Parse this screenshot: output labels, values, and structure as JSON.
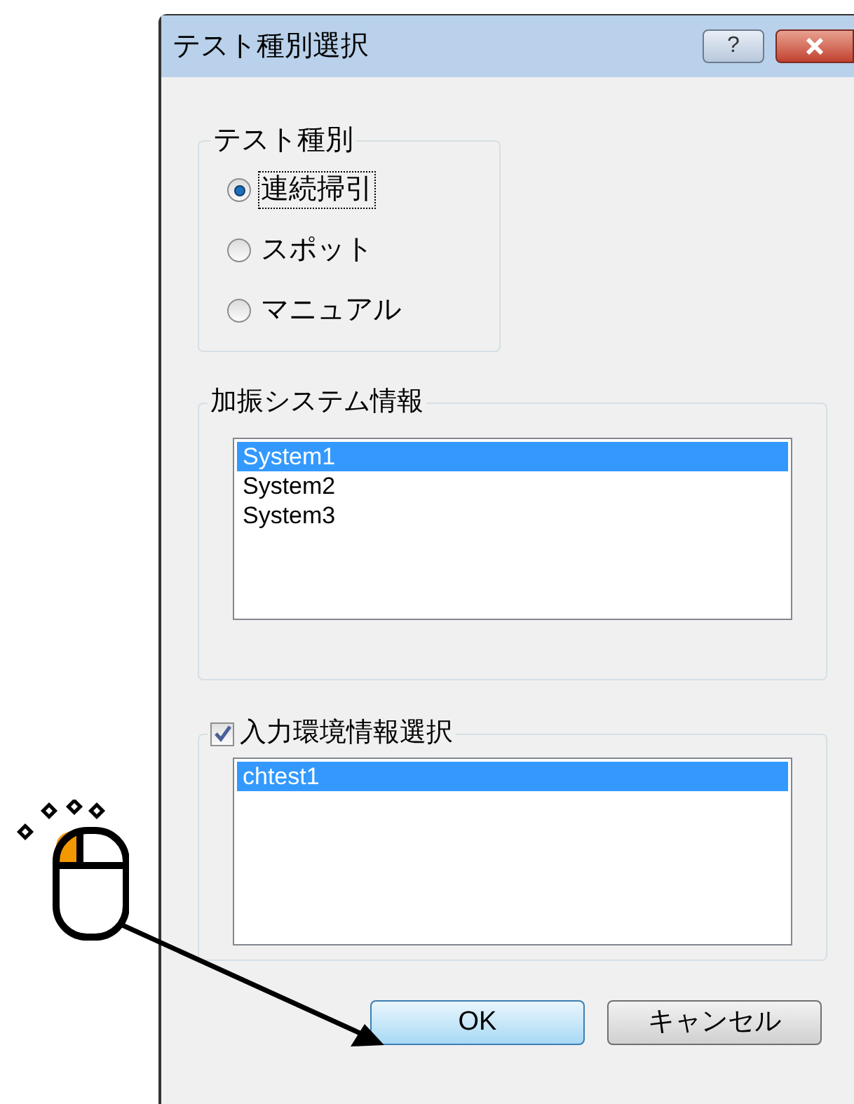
{
  "window": {
    "title": "テスト種別選択",
    "help_button": "?"
  },
  "test_type": {
    "label": "テスト種別",
    "options": [
      {
        "label": "連続掃引",
        "selected": true,
        "focused": true
      },
      {
        "label": "スポット",
        "selected": false,
        "focused": false
      },
      {
        "label": "マニュアル",
        "selected": false,
        "focused": false
      }
    ]
  },
  "system_info": {
    "label": "加振システム情報",
    "items": [
      {
        "label": "System1",
        "selected": true
      },
      {
        "label": "System2",
        "selected": false
      },
      {
        "label": "System3",
        "selected": false
      }
    ]
  },
  "input_env": {
    "label": "入力環境情報選択",
    "checked": true,
    "items": [
      {
        "label": "chtest1",
        "selected": true
      }
    ]
  },
  "buttons": [
    {
      "label": "OK",
      "default": true
    },
    {
      "label": "キャンセル",
      "default": false
    }
  ]
}
